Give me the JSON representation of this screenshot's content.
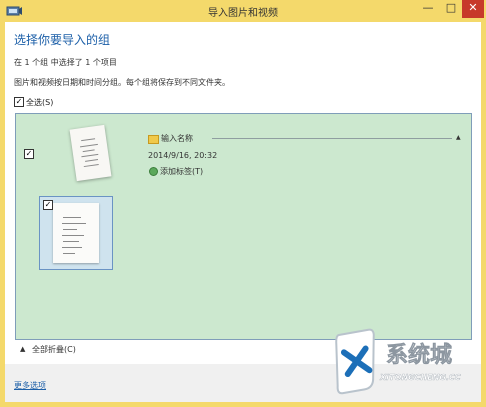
{
  "window": {
    "title": "导入图片和视频",
    "minimize_glyph": "—",
    "maximize_glyph": "□",
    "close_glyph": "✕"
  },
  "dialog": {
    "heading": "选择你要导入的组",
    "selection_summary": "在 1 个组 中选择了 1 个项目",
    "grouping_hint": "图片和视频按日期和时间分组。每个组将保存到不同文件夹。",
    "select_all": {
      "label": "全选(S)",
      "checked": true
    }
  },
  "group": {
    "checked": true,
    "name_placeholder": "输入名称",
    "datetime": "2014/9/16, 20:32",
    "add_tag_label": "添加标签(T)",
    "collapse_glyph": "▲",
    "items": [
      {
        "checked": true
      }
    ]
  },
  "collapse_all": {
    "label": "全部折叠(C)",
    "glyph": "▲"
  },
  "footer": {
    "more_options_label": "更多选项"
  },
  "watermark": {
    "brand": "系统城",
    "url": "XITONGCHENG.CC"
  },
  "colors": {
    "titlebar": "#f4d96b",
    "group_background": "#cce8cf",
    "heading_blue": "#1c5fa8",
    "close_button": "#c7392a"
  },
  "icons": {
    "app": "import-photos-icon",
    "folder": "folder-icon",
    "tag": "tag-icon",
    "collapse": "chevron-up-icon"
  }
}
